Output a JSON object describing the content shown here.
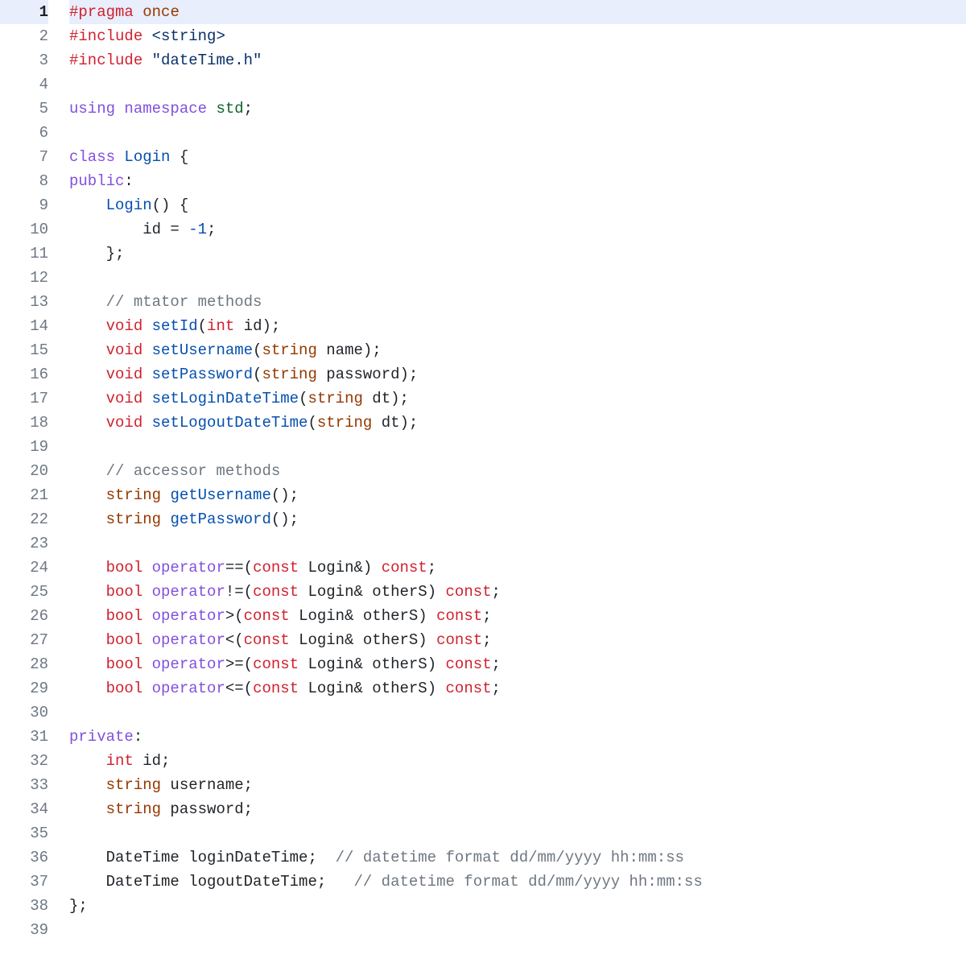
{
  "highlighted_line": 1,
  "lines": [
    {
      "n": 1,
      "tokens": [
        [
          "c-pp",
          "#pragma"
        ],
        [
          "",
          " "
        ],
        [
          "c-cls",
          "once"
        ]
      ]
    },
    {
      "n": 2,
      "tokens": [
        [
          "c-pp",
          "#include"
        ],
        [
          "",
          " "
        ],
        [
          "c-inc",
          "<string>"
        ]
      ]
    },
    {
      "n": 3,
      "tokens": [
        [
          "c-pp",
          "#include"
        ],
        [
          "",
          " "
        ],
        [
          "c-str",
          "\"dateTime.h\""
        ]
      ]
    },
    {
      "n": 4,
      "tokens": []
    },
    {
      "n": 5,
      "tokens": [
        [
          "c-def",
          "using"
        ],
        [
          "",
          " "
        ],
        [
          "c-def",
          "namespace"
        ],
        [
          "",
          " "
        ],
        [
          "c-ref",
          "std"
        ],
        [
          "",
          ";"
        ]
      ]
    },
    {
      "n": 6,
      "tokens": []
    },
    {
      "n": 7,
      "tokens": [
        [
          "c-def",
          "class"
        ],
        [
          "",
          " "
        ],
        [
          "c-func",
          "Login"
        ],
        [
          "",
          " {"
        ]
      ]
    },
    {
      "n": 8,
      "tokens": [
        [
          "c-def",
          "public"
        ],
        [
          "",
          ":"
        ]
      ]
    },
    {
      "n": 9,
      "tokens": [
        [
          "",
          "    "
        ],
        [
          "c-func",
          "Login"
        ],
        [
          "",
          "() {"
        ]
      ]
    },
    {
      "n": 10,
      "tokens": [
        [
          "",
          "        id = "
        ],
        [
          "c-num",
          "-1"
        ],
        [
          "",
          ";"
        ]
      ]
    },
    {
      "n": 11,
      "tokens": [
        [
          "",
          "    };"
        ]
      ]
    },
    {
      "n": 12,
      "tokens": []
    },
    {
      "n": 13,
      "tokens": [
        [
          "",
          "    "
        ],
        [
          "c-cmt",
          "// mtator methods"
        ]
      ]
    },
    {
      "n": 14,
      "tokens": [
        [
          "",
          "    "
        ],
        [
          "c-type",
          "void"
        ],
        [
          "",
          " "
        ],
        [
          "c-func",
          "setId"
        ],
        [
          "",
          "("
        ],
        [
          "c-type",
          "int"
        ],
        [
          "",
          " id);"
        ]
      ]
    },
    {
      "n": 15,
      "tokens": [
        [
          "",
          "    "
        ],
        [
          "c-type",
          "void"
        ],
        [
          "",
          " "
        ],
        [
          "c-func",
          "setUsername"
        ],
        [
          "",
          "("
        ],
        [
          "c-cls",
          "string"
        ],
        [
          "",
          " name);"
        ]
      ]
    },
    {
      "n": 16,
      "tokens": [
        [
          "",
          "    "
        ],
        [
          "c-type",
          "void"
        ],
        [
          "",
          " "
        ],
        [
          "c-func",
          "setPassword"
        ],
        [
          "",
          "("
        ],
        [
          "c-cls",
          "string"
        ],
        [
          "",
          " password);"
        ]
      ]
    },
    {
      "n": 17,
      "tokens": [
        [
          "",
          "    "
        ],
        [
          "c-type",
          "void"
        ],
        [
          "",
          " "
        ],
        [
          "c-func",
          "setLoginDateTime"
        ],
        [
          "",
          "("
        ],
        [
          "c-cls",
          "string"
        ],
        [
          "",
          " dt);"
        ]
      ]
    },
    {
      "n": 18,
      "tokens": [
        [
          "",
          "    "
        ],
        [
          "c-type",
          "void"
        ],
        [
          "",
          " "
        ],
        [
          "c-func",
          "setLogoutDateTime"
        ],
        [
          "",
          "("
        ],
        [
          "c-cls",
          "string"
        ],
        [
          "",
          " dt);"
        ]
      ]
    },
    {
      "n": 19,
      "tokens": []
    },
    {
      "n": 20,
      "tokens": [
        [
          "",
          "    "
        ],
        [
          "c-cmt",
          "// accessor methods"
        ]
      ]
    },
    {
      "n": 21,
      "tokens": [
        [
          "",
          "    "
        ],
        [
          "c-cls",
          "string"
        ],
        [
          "",
          " "
        ],
        [
          "c-func",
          "getUsername"
        ],
        [
          "",
          "();"
        ]
      ]
    },
    {
      "n": 22,
      "tokens": [
        [
          "",
          "    "
        ],
        [
          "c-cls",
          "string"
        ],
        [
          "",
          " "
        ],
        [
          "c-func",
          "getPassword"
        ],
        [
          "",
          "();"
        ]
      ]
    },
    {
      "n": 23,
      "tokens": []
    },
    {
      "n": 24,
      "tokens": [
        [
          "",
          "    "
        ],
        [
          "c-type",
          "bool"
        ],
        [
          "",
          " "
        ],
        [
          "c-def",
          "operator"
        ],
        [
          "",
          "==("
        ],
        [
          "c-type",
          "const"
        ],
        [
          "",
          " Login&) "
        ],
        [
          "c-type",
          "const"
        ],
        [
          "",
          ";"
        ]
      ]
    },
    {
      "n": 25,
      "tokens": [
        [
          "",
          "    "
        ],
        [
          "c-type",
          "bool"
        ],
        [
          "",
          " "
        ],
        [
          "c-def",
          "operator"
        ],
        [
          "",
          "!=("
        ],
        [
          "c-type",
          "const"
        ],
        [
          "",
          " Login& otherS) "
        ],
        [
          "c-type",
          "const"
        ],
        [
          "",
          ";"
        ]
      ]
    },
    {
      "n": 26,
      "tokens": [
        [
          "",
          "    "
        ],
        [
          "c-type",
          "bool"
        ],
        [
          "",
          " "
        ],
        [
          "c-def",
          "operator"
        ],
        [
          "",
          ">("
        ],
        [
          "c-type",
          "const"
        ],
        [
          "",
          " Login& otherS) "
        ],
        [
          "c-type",
          "const"
        ],
        [
          "",
          ";"
        ]
      ]
    },
    {
      "n": 27,
      "tokens": [
        [
          "",
          "    "
        ],
        [
          "c-type",
          "bool"
        ],
        [
          "",
          " "
        ],
        [
          "c-def",
          "operator"
        ],
        [
          "",
          "<("
        ],
        [
          "c-type",
          "const"
        ],
        [
          "",
          " Login& otherS) "
        ],
        [
          "c-type",
          "const"
        ],
        [
          "",
          ";"
        ]
      ]
    },
    {
      "n": 28,
      "tokens": [
        [
          "",
          "    "
        ],
        [
          "c-type",
          "bool"
        ],
        [
          "",
          " "
        ],
        [
          "c-def",
          "operator"
        ],
        [
          "",
          ">=("
        ],
        [
          "c-type",
          "const"
        ],
        [
          "",
          " Login& otherS) "
        ],
        [
          "c-type",
          "const"
        ],
        [
          "",
          ";"
        ]
      ]
    },
    {
      "n": 29,
      "tokens": [
        [
          "",
          "    "
        ],
        [
          "c-type",
          "bool"
        ],
        [
          "",
          " "
        ],
        [
          "c-def",
          "operator"
        ],
        [
          "",
          "<=("
        ],
        [
          "c-type",
          "const"
        ],
        [
          "",
          " Login& otherS) "
        ],
        [
          "c-type",
          "const"
        ],
        [
          "",
          ";"
        ]
      ]
    },
    {
      "n": 30,
      "tokens": []
    },
    {
      "n": 31,
      "tokens": [
        [
          "c-def",
          "private"
        ],
        [
          "",
          ":"
        ]
      ]
    },
    {
      "n": 32,
      "tokens": [
        [
          "",
          "    "
        ],
        [
          "c-type",
          "int"
        ],
        [
          "",
          " id;"
        ]
      ]
    },
    {
      "n": 33,
      "tokens": [
        [
          "",
          "    "
        ],
        [
          "c-cls",
          "string"
        ],
        [
          "",
          " username;"
        ]
      ]
    },
    {
      "n": 34,
      "tokens": [
        [
          "",
          "    "
        ],
        [
          "c-cls",
          "string"
        ],
        [
          "",
          " password;"
        ]
      ]
    },
    {
      "n": 35,
      "tokens": []
    },
    {
      "n": 36,
      "tokens": [
        [
          "",
          "    DateTime loginDateTime;  "
        ],
        [
          "c-cmt",
          "// datetime format dd/mm/yyyy hh:mm:ss"
        ]
      ]
    },
    {
      "n": 37,
      "tokens": [
        [
          "",
          "    DateTime logoutDateTime;   "
        ],
        [
          "c-cmt",
          "// datetime format dd/mm/yyyy hh:mm:ss"
        ]
      ]
    },
    {
      "n": 38,
      "tokens": [
        [
          "",
          "};"
        ]
      ]
    },
    {
      "n": 39,
      "tokens": []
    }
  ]
}
